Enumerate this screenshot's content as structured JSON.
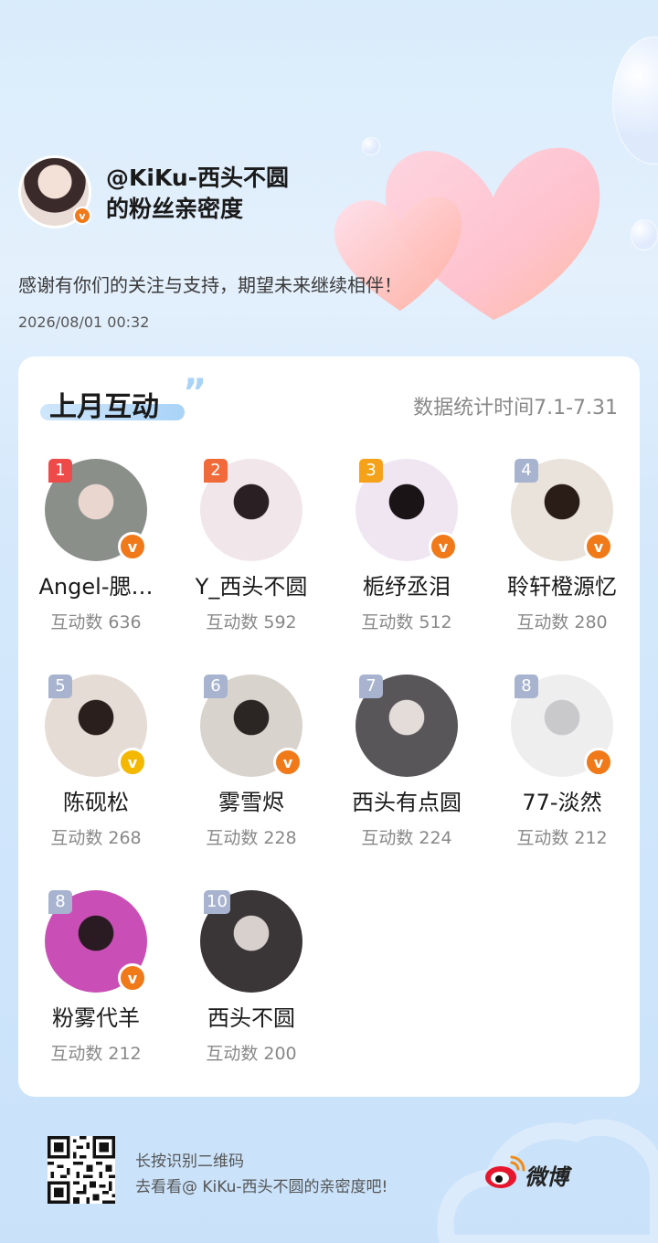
{
  "owner": {
    "name": "@KiKu-西头不圆",
    "subtitle": "的粉丝亲密度",
    "verified_badge": "v",
    "thanks": "感谢有你们的关注与支持，期望未来继续相伴！",
    "timestamp": "2026/08/01  00:32"
  },
  "card": {
    "title": "上月互动",
    "quote": "”",
    "stat_time": "数据统计时间7.1-7.31"
  },
  "fans": [
    {
      "rank": "1",
      "name": "Angel-腮…",
      "count": "互动数 636",
      "badge": "v",
      "rank_color": "#ee4a4a",
      "badge_color": "#f07a1a",
      "avatar_bg": "#8a8f8a",
      "avatar_fg": "#e8d6cf"
    },
    {
      "rank": "2",
      "name": "Y_西头不圆",
      "count": "互动数 592",
      "badge": "",
      "rank_color": "#f06a3a",
      "badge_color": "",
      "avatar_bg": "#f1e6ea",
      "avatar_fg": "#2a1f22"
    },
    {
      "rank": "3",
      "name": "栀纾丞泪",
      "count": "互动数 512",
      "badge": "v",
      "rank_color": "#f5a21a",
      "badge_color": "#f07a1a",
      "avatar_bg": "#efe6f2",
      "avatar_fg": "#1a1416"
    },
    {
      "rank": "4",
      "name": "聆轩橙源忆",
      "count": "互动数 280",
      "badge": "v",
      "rank_color": "#a8b4cf",
      "badge_color": "#f07a1a",
      "avatar_bg": "#e9e3dc",
      "avatar_fg": "#2a1d18"
    },
    {
      "rank": "5",
      "name": "陈砚松",
      "count": "互动数 268",
      "badge": "v",
      "rank_color": "#a8b4cf",
      "badge_color": "#f5b800",
      "avatar_bg": "#e6dcd6",
      "avatar_fg": "#2a1f1c"
    },
    {
      "rank": "6",
      "name": "雾雪烬",
      "count": "互动数 228",
      "badge": "v",
      "rank_color": "#a8b4cf",
      "badge_color": "#f07a1a",
      "avatar_bg": "#d9d3cd",
      "avatar_fg": "#2b2624"
    },
    {
      "rank": "7",
      "name": "西头有点圆",
      "count": "互动数 224",
      "badge": "",
      "rank_color": "#a8b4cf",
      "badge_color": "",
      "avatar_bg": "#595659",
      "avatar_fg": "#e3dcd8"
    },
    {
      "rank": "8",
      "name": "77-淡然",
      "count": "互动数 212",
      "badge": "v",
      "rank_color": "#a8b4cf",
      "badge_color": "#f07a1a",
      "avatar_bg": "#eeeeee",
      "avatar_fg": "#c9c9cc"
    },
    {
      "rank": "8",
      "name": "粉雾代羊",
      "count": "互动数 212",
      "badge": "v",
      "rank_color": "#a8b4cf",
      "badge_color": "#f07a1a",
      "avatar_bg": "#c94fb6",
      "avatar_fg": "#2a1a22"
    },
    {
      "rank": "10",
      "name": "西头不圆",
      "count": "互动数 200",
      "badge": "",
      "rank_color": "#a8b4cf",
      "badge_color": "",
      "avatar_bg": "#3a3638",
      "avatar_fg": "#d8d0cc"
    }
  ],
  "footer": {
    "line1": "长按识别二维码",
    "line2": "去看看@ KiKu-西头不圆的亲密度吧!",
    "brand": "微博"
  }
}
